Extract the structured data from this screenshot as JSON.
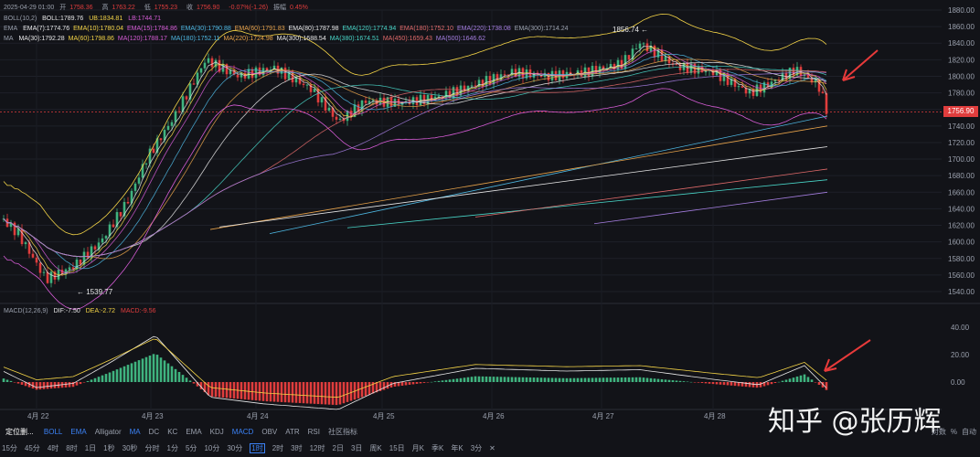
{
  "colors": {
    "bg": "#121318",
    "up": "#3fb37f",
    "down": "#e03d3d",
    "accent": "#3b82f6",
    "arrow": "#e83a3a"
  },
  "header": {
    "datetime": "2025-04-29 01:00",
    "open_label": "开",
    "open": "1758.36",
    "high_label": "高",
    "high": "1763.22",
    "low_label": "低",
    "low": "1755.23",
    "close_label": "收",
    "close": "1756.90",
    "change": "-0.07%(-1.26)",
    "amp_label": "振幅",
    "amp": "0.45%"
  },
  "boll": {
    "name": "BOLL(10,2)",
    "mid": "BOLL:1789.76",
    "ub": "UB:1834.81",
    "lb": "LB:1744.71"
  },
  "ema": {
    "name": "EMA",
    "items": [
      {
        "label": "EMA(7):1774.76",
        "color": "#e8e8e8"
      },
      {
        "label": "EMA(10):1780.04",
        "color": "#f5d547"
      },
      {
        "label": "EMA(15):1784.86",
        "color": "#d65cd6"
      },
      {
        "label": "EMA(30):1790.88",
        "color": "#4db6e0"
      },
      {
        "label": "EMA(60):1791.83",
        "color": "#e8a34a"
      },
      {
        "label": "EMA(80):1787.98",
        "color": "#e8e8e8"
      },
      {
        "label": "EMA(120):1774.94",
        "color": "#49d6c8"
      },
      {
        "label": "EMA(180):1752.10",
        "color": "#e06a6a"
      },
      {
        "label": "EMA(220):1738.08",
        "color": "#a57ee0"
      },
      {
        "label": "EMA(300):1714.24",
        "color": "#9aa0ad"
      }
    ]
  },
  "ma": {
    "name": "MA",
    "items": [
      {
        "label": "MA(30):1792.28",
        "color": "#e8e8e8"
      },
      {
        "label": "MA(60):1798.86",
        "color": "#f5d547"
      },
      {
        "label": "MA(120):1788.17",
        "color": "#d65cd6"
      },
      {
        "label": "MA(180):1752.11",
        "color": "#4db6e0"
      },
      {
        "label": "MA(220):1724.98",
        "color": "#e8a34a"
      },
      {
        "label": "MA(300):1688.54",
        "color": "#e8e8e8"
      },
      {
        "label": "MA(380):1674.51",
        "color": "#49d6c8"
      },
      {
        "label": "MA(450):1659.43",
        "color": "#e06a6a"
      },
      {
        "label": "MA(500):1646.62",
        "color": "#a57ee0"
      }
    ]
  },
  "price_axis": [
    "1880.00",
    "1860.00",
    "1840.00",
    "1820.00",
    "1800.00",
    "1780.00",
    "1760.00",
    "1740.00",
    "1720.00",
    "1700.00",
    "1680.00",
    "1660.00",
    "1640.00",
    "1620.00",
    "1600.00",
    "1580.00",
    "1560.00",
    "1540.00"
  ],
  "current_price": "1756.90",
  "high_mark": "1856.74",
  "low_mark": "1539.77",
  "macd": {
    "name": "MACD(12,26,9)",
    "dif": "DIF:-7.50",
    "dea": "DEA:-2.72",
    "macd": "MACD:-9.56",
    "axis": [
      "40.00",
      "20.00",
      "0.00"
    ]
  },
  "date_axis": [
    "4月 22",
    "4月 23",
    "4月 24",
    "4月 25",
    "4月 26",
    "4月 27",
    "4月 28"
  ],
  "watermark": "知乎 @张历辉",
  "toolbar_row1": {
    "tag": "定位删...",
    "indicators": [
      "BOLL",
      "EMA",
      "Alligator",
      "MA",
      "DC",
      "KC",
      "EMA",
      "KDJ",
      "MACD",
      "OBV",
      "ATR",
      "RSI"
    ],
    "active": [
      "BOLL",
      "EMA",
      "MA",
      "MACD"
    ],
    "community": "社区指标",
    "right": [
      "对数",
      "%",
      "自动"
    ]
  },
  "toolbar_row2": {
    "intervals": [
      "15分",
      "45分",
      "4时",
      "8时",
      "1日",
      "1秒",
      "30秒",
      "分时",
      "1分",
      "5分",
      "10分",
      "30分",
      "1时",
      "2时",
      "3时",
      "12时",
      "2日",
      "3日",
      "周K",
      "15日",
      "月K",
      "季K",
      "年K",
      "3分"
    ],
    "selected": "1时"
  }
}
